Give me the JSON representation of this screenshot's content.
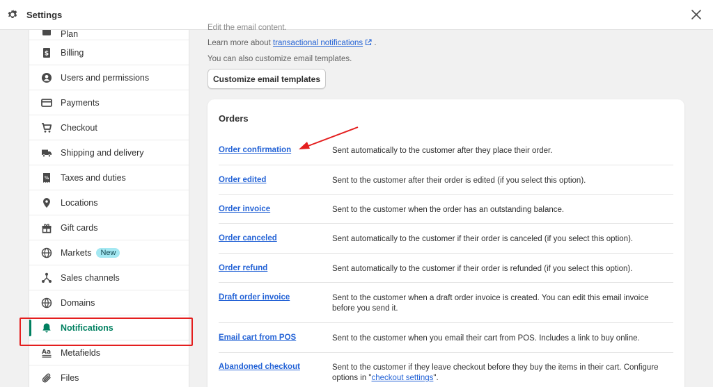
{
  "header": {
    "title": "Settings",
    "close_label": "Close"
  },
  "sidebar": {
    "items": [
      {
        "label": "Plan",
        "icon": "plan-icon"
      },
      {
        "label": "Billing",
        "icon": "billing-icon"
      },
      {
        "label": "Users and permissions",
        "icon": "users-icon"
      },
      {
        "label": "Payments",
        "icon": "payments-icon"
      },
      {
        "label": "Checkout",
        "icon": "checkout-cart-icon"
      },
      {
        "label": "Shipping and delivery",
        "icon": "truck-icon"
      },
      {
        "label": "Taxes and duties",
        "icon": "taxes-icon"
      },
      {
        "label": "Locations",
        "icon": "location-pin-icon"
      },
      {
        "label": "Gift cards",
        "icon": "gift-icon"
      },
      {
        "label": "Markets",
        "icon": "globe-icon",
        "badge": "New"
      },
      {
        "label": "Sales channels",
        "icon": "sales-channels-icon"
      },
      {
        "label": "Domains",
        "icon": "domains-globe-icon"
      },
      {
        "label": "Notifications",
        "icon": "bell-icon",
        "active": true
      },
      {
        "label": "Metafields",
        "icon": "metafields-icon"
      },
      {
        "label": "Files",
        "icon": "paperclip-icon"
      }
    ]
  },
  "main": {
    "cut_text": "Edit the email content.",
    "learn_more_prefix": "Learn more about ",
    "learn_more_link": "transactional notifications",
    "learn_more_suffix": " .",
    "customize_text": "You can also customize email templates.",
    "customize_button": "Customize email templates"
  },
  "orders": {
    "title": "Orders",
    "rows": [
      {
        "name": "Order confirmation",
        "desc": "Sent automatically to the customer after they place their order."
      },
      {
        "name": "Order edited",
        "desc": "Sent to the customer after their order is edited (if you select this option)."
      },
      {
        "name": "Order invoice",
        "desc": "Sent to the customer when the order has an outstanding balance."
      },
      {
        "name": "Order canceled",
        "desc": "Sent automatically to the customer if their order is canceled (if you select this option)."
      },
      {
        "name": "Order refund",
        "desc": "Sent automatically to the customer if their order is refunded (if you select this option)."
      },
      {
        "name": "Draft order invoice",
        "desc": "Sent to the customer when a draft order invoice is created. You can edit this email invoice before you send it."
      },
      {
        "name": "Email cart from POS",
        "desc": "Sent to the customer when you email their cart from POS. Includes a link to buy online."
      },
      {
        "name": "Abandoned checkout",
        "desc_prefix": "Sent to the customer if they leave checkout before they buy the items in their cart. Configure options in \"",
        "desc_link": "checkout settings",
        "desc_suffix": "\"."
      }
    ]
  },
  "colors": {
    "accent_green": "#008060",
    "link_blue": "#2463d6",
    "annotation_red": "#e41e1e",
    "badge_bg": "#a4e8f2"
  }
}
